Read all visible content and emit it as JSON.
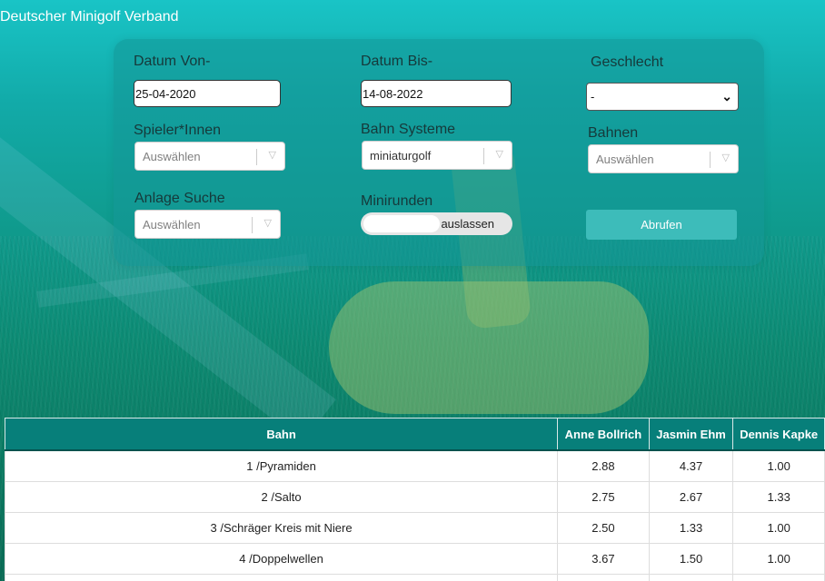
{
  "header": {
    "title": "Deutscher Minigolf Verband"
  },
  "filters": {
    "datum_von": {
      "label": "Datum Von-",
      "value": "25-04-2020"
    },
    "datum_bis": {
      "label": "Datum Bis-",
      "value": "14-08-2022"
    },
    "geschlecht": {
      "label": "Geschlecht",
      "value": "-"
    },
    "spieler": {
      "label": "Spieler*Innen",
      "placeholder": "Auswählen"
    },
    "bahn_systeme": {
      "label": "Bahn Systeme",
      "value": "miniaturgolf"
    },
    "bahnen": {
      "label": "Bahnen",
      "placeholder": "Auswählen"
    },
    "anlage": {
      "label": "Anlage Suche",
      "placeholder": "Auswählen"
    },
    "minirunden": {
      "label": "Minirunden",
      "toggle_text": "auslassen"
    },
    "submit_label": "Abrufen"
  },
  "table": {
    "headers": [
      "Bahn",
      "Anne Bollrich",
      "Jasmin Ehm",
      "Dennis Kapke"
    ],
    "rows": [
      [
        "1 /Pyramiden",
        "2.88",
        "4.37",
        "1.00"
      ],
      [
        "2 /Salto",
        "2.75",
        "2.67",
        "1.33"
      ],
      [
        "3 /Schräger Kreis mit Niere",
        "2.50",
        "1.33",
        "1.00"
      ],
      [
        "4 /Doppelwellen",
        "3.67",
        "1.50",
        "1.00"
      ],
      [
        "",
        "",
        "",
        ""
      ]
    ]
  }
}
